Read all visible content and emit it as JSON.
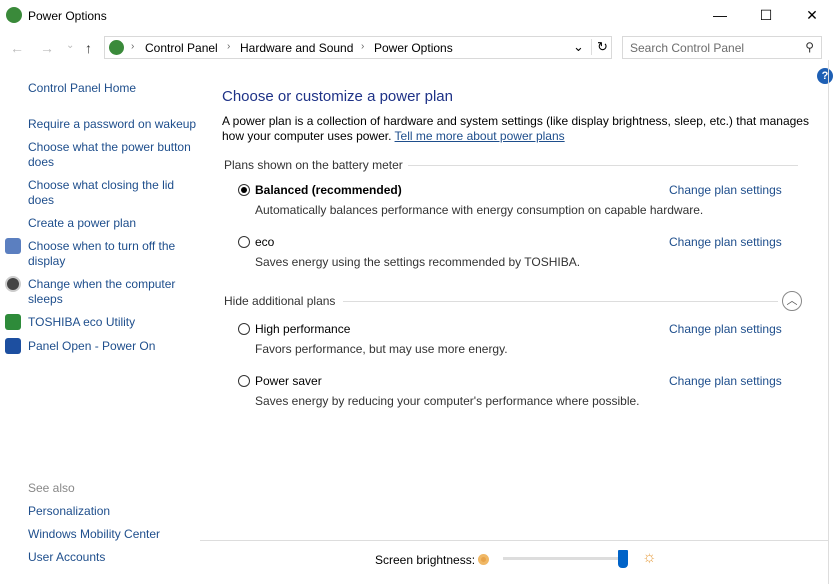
{
  "window": {
    "title": "Power Options",
    "minimize": "—",
    "maximize": "☐",
    "close": "✕"
  },
  "nav": {
    "back": "←",
    "forward": "→",
    "recent": "⌄",
    "up": "↑"
  },
  "address": {
    "crumbs": [
      "Control Panel",
      "Hardware and Sound",
      "Power Options"
    ],
    "dropdown": "⌄",
    "refresh": "↻"
  },
  "search": {
    "placeholder": "Search Control Panel"
  },
  "help": "?",
  "sidebar": {
    "home": "Control Panel Home",
    "items": [
      "Require a password on wakeup",
      "Choose what the power button does",
      "Choose what closing the lid does",
      "Create a power plan",
      "Choose when to turn off the display",
      "Change when the computer sleeps",
      "TOSHIBA eco Utility",
      "Panel Open - Power On"
    ],
    "see_also": "See also",
    "see_also_items": [
      "Personalization",
      "Windows Mobility Center",
      "User Accounts"
    ]
  },
  "main": {
    "title": "Choose or customize a power plan",
    "description": "A power plan is a collection of hardware and system settings (like display brightness, sleep, etc.) that manages how your computer uses power.",
    "learn_more": "Tell me more about power plans",
    "battery_group": "Plans shown on the battery meter",
    "hidden_group": "Hide additional plans",
    "change_label": "Change plan settings",
    "plans": [
      {
        "name": "Balanced (recommended)",
        "desc": "Automatically balances performance with energy consumption on capable hardware.",
        "selected": true
      },
      {
        "name": "eco",
        "desc": "Saves energy using the settings recommended by TOSHIBA.",
        "selected": false
      },
      {
        "name": "High performance",
        "desc": "Favors performance, but may use more energy.",
        "selected": false
      },
      {
        "name": "Power saver",
        "desc": "Saves energy by reducing your computer's performance where possible.",
        "selected": false
      }
    ]
  },
  "brightness": {
    "label": "Screen brightness:",
    "value_percent": 100
  },
  "colors": {
    "link": "#1e4e8c",
    "title": "#1e3287",
    "slider_thumb": "#0063c8"
  }
}
